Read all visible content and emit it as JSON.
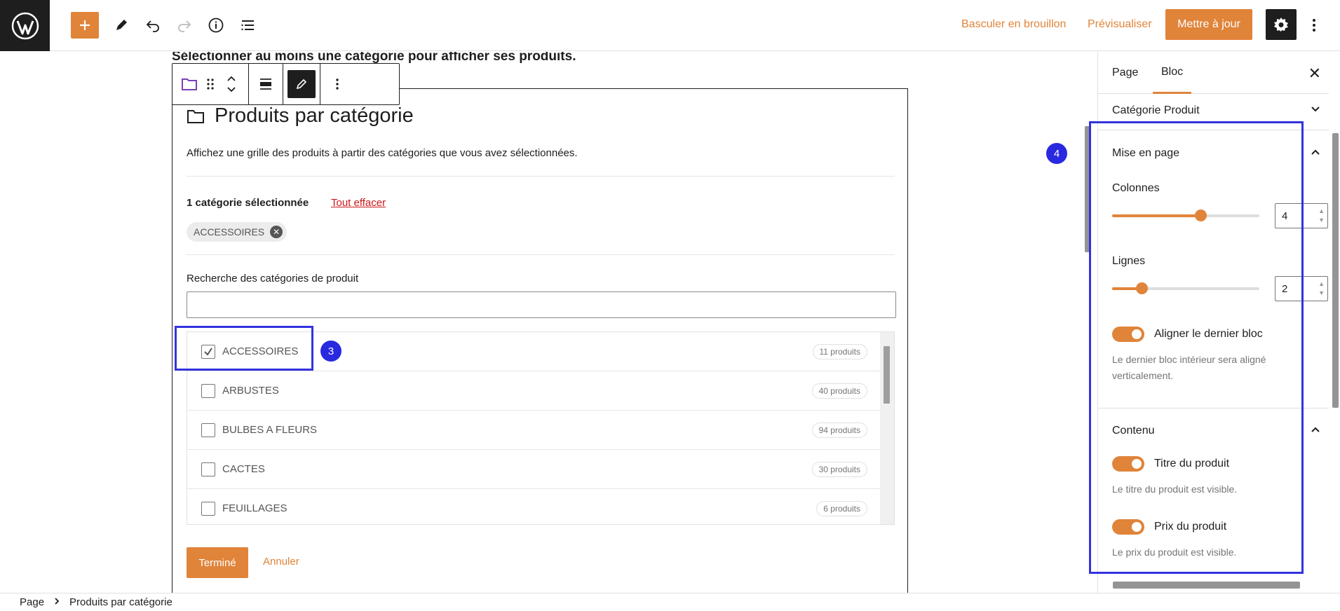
{
  "header": {
    "switch_draft": "Basculer en brouillon",
    "preview": "Prévisualiser",
    "update": "Mettre à jour"
  },
  "canvas": {
    "prev_text": "Sélectionner au moins une catégorie pour afficher ses produits.",
    "block": {
      "title": "Produits par catégorie",
      "description": "Affichez une grille des produits à partir des catégories que vous avez sélectionnées.",
      "selected_count": "1 catégorie sélectionnée",
      "clear_all": "Tout effacer",
      "chip": "ACCESSOIRES",
      "search_label": "Recherche des catégories de produit",
      "search_value": "",
      "categories": [
        {
          "label": "ACCESSOIRES",
          "count": "11 produits",
          "checked": true
        },
        {
          "label": "ARBUSTES",
          "count": "40 produits",
          "checked": false
        },
        {
          "label": "BULBES A FLEURS",
          "count": "94 produits",
          "checked": false
        },
        {
          "label": "CACTES",
          "count": "30 produits",
          "checked": false
        },
        {
          "label": "FEUILLAGES",
          "count": "6 produits",
          "checked": false
        }
      ],
      "done": "Terminé",
      "cancel": "Annuler"
    },
    "annotations": {
      "badge3": "3",
      "badge4": "4"
    }
  },
  "sidebar": {
    "tab_page": "Page",
    "tab_block": "Bloc",
    "category_panel": "Catégorie Produit",
    "layout_panel": "Mise en page",
    "columns_label": "Colonnes",
    "columns_value": "4",
    "columns_fraction": 0.6,
    "rows_label": "Lignes",
    "rows_value": "2",
    "rows_fraction": 0.2,
    "align_toggle": "Aligner le dernier bloc",
    "align_help": "Le dernier bloc intérieur sera aligné verticalement.",
    "content_panel": "Contenu",
    "title_toggle": "Titre du produit",
    "title_help": "Le titre du produit est visible.",
    "price_toggle": "Prix du produit",
    "price_help": "Le prix du produit est visible."
  },
  "breadcrumb": {
    "root": "Page",
    "current": "Produits par catégorie"
  },
  "colors": {
    "accent": "#e0843a",
    "annotation": "#3333dd",
    "dark": "#1e1e1e"
  }
}
